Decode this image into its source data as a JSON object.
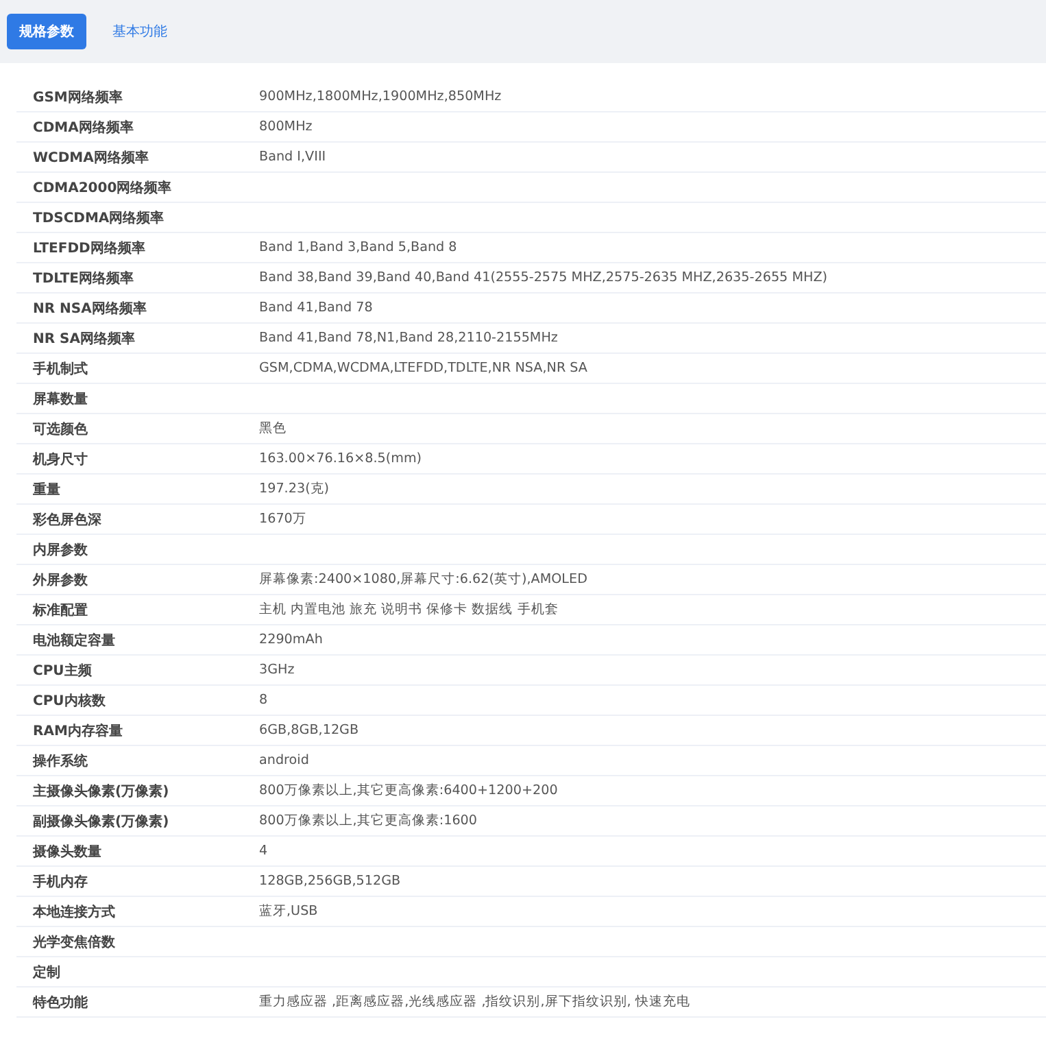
{
  "tabs": [
    {
      "label": "规格参数",
      "selected": true
    },
    {
      "label": "基本功能",
      "selected": false
    }
  ],
  "specs": [
    {
      "label": "GSM网络频率",
      "value": "900MHz,1800MHz,1900MHz,850MHz"
    },
    {
      "label": "CDMA网络频率",
      "value": "800MHz"
    },
    {
      "label": "WCDMA网络频率",
      "value": "Band Ⅰ,VIII"
    },
    {
      "label": "CDMA2000网络频率"
    },
    {
      "label": "TDSCDMA网络频率"
    },
    {
      "label": "LTEFDD网络频率",
      "value": "Band 1,Band 3,Band 5,Band 8"
    },
    {
      "label": "TDLTE网络频率",
      "value": "Band 38,Band 39,Band 40,Band 41(2555-2575 MHZ,2575-2635 MHZ,2635-2655 MHZ)"
    },
    {
      "label": "NR NSA网络频率",
      "value": "Band 41,Band 78"
    },
    {
      "label": "NR SA网络频率",
      "value": "Band 41,Band 78,N1,Band 28,2110-2155MHz"
    },
    {
      "label": "手机制式",
      "value": "GSM,CDMA,WCDMA,LTEFDD,TDLTE,NR NSA,NR SA"
    },
    {
      "label": "屏幕数量"
    },
    {
      "label": "可选颜色",
      "value": "黑色"
    },
    {
      "label": "机身尺寸",
      "value": "163.00×76.16×8.5(mm)"
    },
    {
      "label": "重量",
      "value": "197.23(克)"
    },
    {
      "label": "彩色屏色深",
      "value": "1670万"
    },
    {
      "label": "内屏参数"
    },
    {
      "label": "外屏参数",
      "value": "屏幕像素:2400×1080,屏幕尺寸:6.62(英寸),AMOLED"
    },
    {
      "label": "标准配置",
      "value": "主机 内置电池 旅充 说明书 保修卡 数据线 手机套"
    },
    {
      "label": "电池额定容量",
      "value": "2290mAh"
    },
    {
      "label": "CPU主频",
      "value": "3GHz"
    },
    {
      "label": "CPU内核数",
      "value": "8"
    },
    {
      "label": "RAM内存容量",
      "value": "6GB,8GB,12GB"
    },
    {
      "label": "操作系统",
      "value": "android"
    },
    {
      "label": "主摄像头像素(万像素)",
      "value": "800万像素以上,其它更高像素:6400+1200+200"
    },
    {
      "label": "副摄像头像素(万像素)",
      "value": "800万像素以上,其它更高像素:1600"
    },
    {
      "label": "摄像头数量",
      "value": "4"
    },
    {
      "label": "手机内存",
      "value": "128GB,256GB,512GB"
    },
    {
      "label": "本地连接方式",
      "value": "蓝牙,USB"
    },
    {
      "label": "光学变焦倍数"
    },
    {
      "label": "定制"
    },
    {
      "label": "特色功能",
      "value": "重力感应器 ,距离感应器,光线感应器 ,指纹识别,屏下指纹识别, 快速充电"
    }
  ]
}
